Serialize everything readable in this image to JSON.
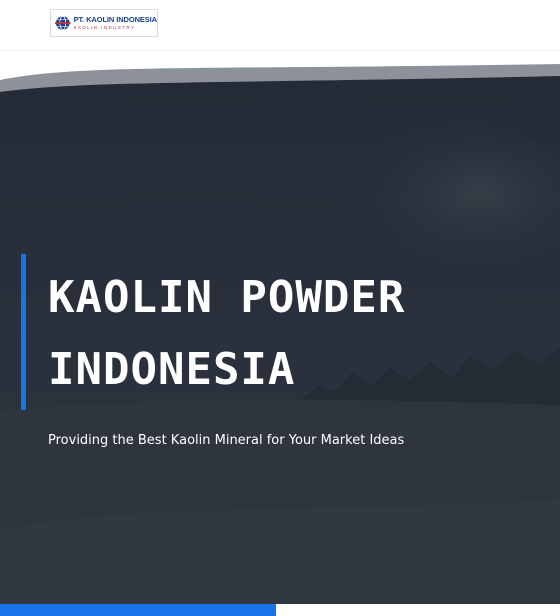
{
  "header": {
    "logo": {
      "title": "PT. KAOLIN INDONESIA",
      "subtitle": "KAOLIN INDUSTRY",
      "icon": "globe-icon"
    }
  },
  "hero": {
    "title": "KAOLIN POWDER INDONESIA",
    "subtitle": "Providing the Best Kaolin Mineral for Your Market Ideas"
  },
  "colors": {
    "hero_overlay": "#2a303b",
    "accent": "#1a73e8",
    "swoosh": "#8d929a"
  }
}
